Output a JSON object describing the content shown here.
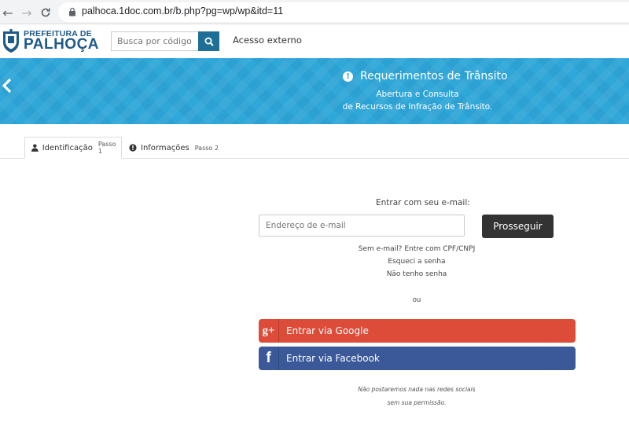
{
  "browser": {
    "url": "palhoca.1doc.com.br/b.php?pg=wp/wp&itd=11"
  },
  "header": {
    "logo_line1": "PREFEITURA DE",
    "logo_line2": "PALHOÇA",
    "search_placeholder": "Busca por código",
    "external_access": "Acesso externo"
  },
  "banner": {
    "title": "Requerimentos de Trânsito",
    "subtitle_line1": "Abertura e Consulta",
    "subtitle_line2": "de Recursos de Infração de Trânsito."
  },
  "tabs": [
    {
      "label": "Identificação",
      "step": "Passo 1",
      "active": true
    },
    {
      "label": "Informações",
      "step": "Passo 2",
      "active": false
    }
  ],
  "form": {
    "email_label": "Entrar com seu e-mail:",
    "email_placeholder": "Endereço de e-mail",
    "submit_label": "Prosseguir",
    "no_email_link": "Sem e-mail? Entre com CPF/CNPJ",
    "forgot_password": "Esqueci a senha",
    "no_password": "Não tenho senha",
    "or": "ou"
  },
  "social": {
    "google_label": "Entrar via Google",
    "google_icon_text": "g+",
    "facebook_label": "Entrar via Facebook",
    "facebook_icon_text": "f",
    "note_line1": "Não postaremos nada nas redes sociais",
    "note_line2": "sem sua permissão."
  },
  "colors": {
    "banner": "#2fa7d8",
    "search_button": "#1f6e96",
    "google": "#dd4b39",
    "facebook": "#3b5998",
    "submit": "#333333"
  }
}
